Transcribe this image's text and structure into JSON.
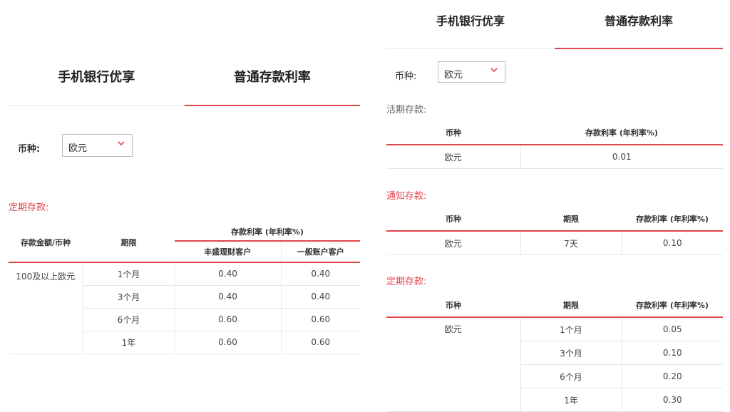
{
  "left": {
    "tabs": [
      {
        "label": "手机银行优享"
      },
      {
        "label": "普通存款利率"
      }
    ],
    "currency_label": "币种:",
    "currency_value": "欧元",
    "section_title": "定期存款:",
    "table": {
      "col_amount": "存款金额/币种",
      "col_term": "期限",
      "col_rate": "存款利率 (年利率%)",
      "col_rate_a": "丰盛理财客户",
      "col_rate_b": "一般账户客户",
      "amount": "100及以上欧元",
      "rows": [
        {
          "term": "1个月",
          "a": "0.40",
          "b": "0.40"
        },
        {
          "term": "3个月",
          "a": "0.40",
          "b": "0.40"
        },
        {
          "term": "6个月",
          "a": "0.60",
          "b": "0.60"
        },
        {
          "term": "1年",
          "a": "0.60",
          "b": "0.60"
        }
      ]
    }
  },
  "right": {
    "tabs": [
      {
        "label": "手机银行优享"
      },
      {
        "label": "普通存款利率"
      }
    ],
    "currency_label": "币种:",
    "currency_value": "欧元",
    "demand": {
      "title": "活期存款:",
      "col_currency": "币种",
      "col_rate": "存款利率 (年利率%)",
      "row": {
        "currency": "欧元",
        "rate": "0.01"
      }
    },
    "notice": {
      "title": "通知存款:",
      "col_currency": "币种",
      "col_term": "期限",
      "col_rate": "存款利率 (年利率%)",
      "row": {
        "currency": "欧元",
        "term": "7天",
        "rate": "0.10"
      }
    },
    "fixed": {
      "title": "定期存款:",
      "col_currency": "币种",
      "col_term": "期限",
      "col_rate": "存款利率 (年利率%)",
      "currency": "欧元",
      "rows": [
        {
          "term": "1个月",
          "rate": "0.05"
        },
        {
          "term": "3个月",
          "rate": "0.10"
        },
        {
          "term": "6个月",
          "rate": "0.20"
        },
        {
          "term": "1年",
          "rate": "0.30"
        }
      ]
    }
  },
  "colors": {
    "accent": "#e0474c"
  }
}
